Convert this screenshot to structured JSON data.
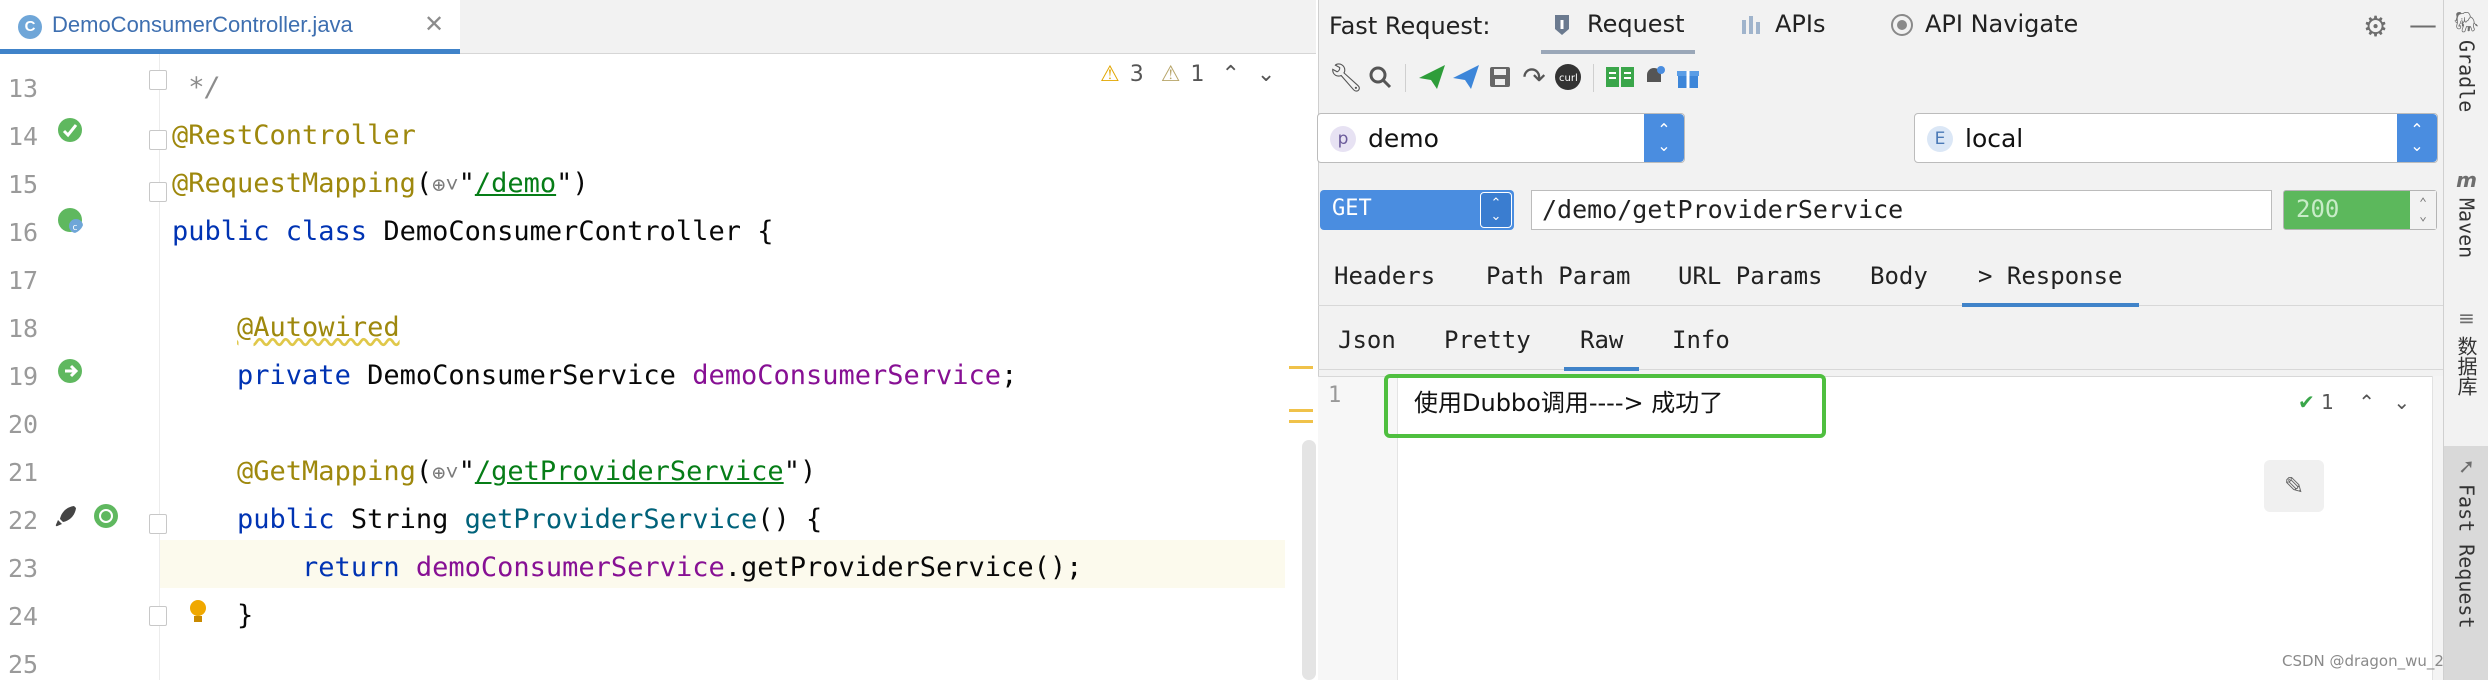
{
  "editor": {
    "tab": {
      "icon_letter": "C",
      "filename": "DemoConsumerController.java",
      "close": "✕"
    },
    "inspections": {
      "warnings": "3",
      "weak_warnings": "1"
    },
    "lines": [
      {
        "n": "13",
        "html": "<span class='cmt'> */</span>"
      },
      {
        "n": "14",
        "html": "<span class='ann'>@RestController</span>"
      },
      {
        "n": "15",
        "html": "<span class='ann'>@RequestMapping</span>(<span class='globe'>⊕˅</span>\"<span class='str ul'>/demo</span>\")"
      },
      {
        "n": "16",
        "html": "<span class='kw'>public class</span> DemoConsumerController {"
      },
      {
        "n": "17",
        "html": ""
      },
      {
        "n": "18",
        "html": "    <span class='ann squig'>@Autowired</span>"
      },
      {
        "n": "19",
        "html": "    <span class='kw'>private</span> DemoConsumerService <span class='fld'>demoConsumerService</span>;"
      },
      {
        "n": "20",
        "html": ""
      },
      {
        "n": "21",
        "html": "    <span class='ann'>@GetMapping</span>(<span class='globe'>⊕˅</span>\"<span class='str ul'>/getProviderService</span>\")"
      },
      {
        "n": "22",
        "html": "    <span class='kw'>public</span> String <span class='mth'>getProviderService</span>() {"
      },
      {
        "n": "23",
        "html": "        <span class='kw'>return</span> <span class='fld'>demoConsumerService</span>.getProviderService();"
      },
      {
        "n": "24",
        "html": "    }"
      },
      {
        "n": "25",
        "html": ""
      }
    ]
  },
  "fast_request": {
    "title": "Fast Request:",
    "tabs": [
      "Request",
      "APIs",
      "API Navigate"
    ],
    "project": {
      "badge": "p",
      "value": "demo"
    },
    "env": {
      "badge": "E",
      "value": "local"
    },
    "method": "GET",
    "url": "/demo/getProviderService",
    "status": "200",
    "request_tabs": [
      "Headers",
      "Path Param",
      "URL Params",
      "Body",
      "> Response"
    ],
    "response_tabs": [
      "Json",
      "Pretty",
      "Raw",
      "Info"
    ],
    "response": {
      "line": "1",
      "text": "使用Dubbo调用----> 成功了",
      "check_count": "1"
    }
  },
  "right_strip": {
    "tools": [
      "Gradle",
      "Maven",
      "数据库",
      "Fast Request"
    ]
  },
  "watermark": "CSDN @dragon_wu_2",
  "colors": {
    "accent": "#4a8de0",
    "status_ok": "#5cb85c",
    "highlight_box": "#4fbf3f",
    "send_green": "#2e9d3a"
  }
}
